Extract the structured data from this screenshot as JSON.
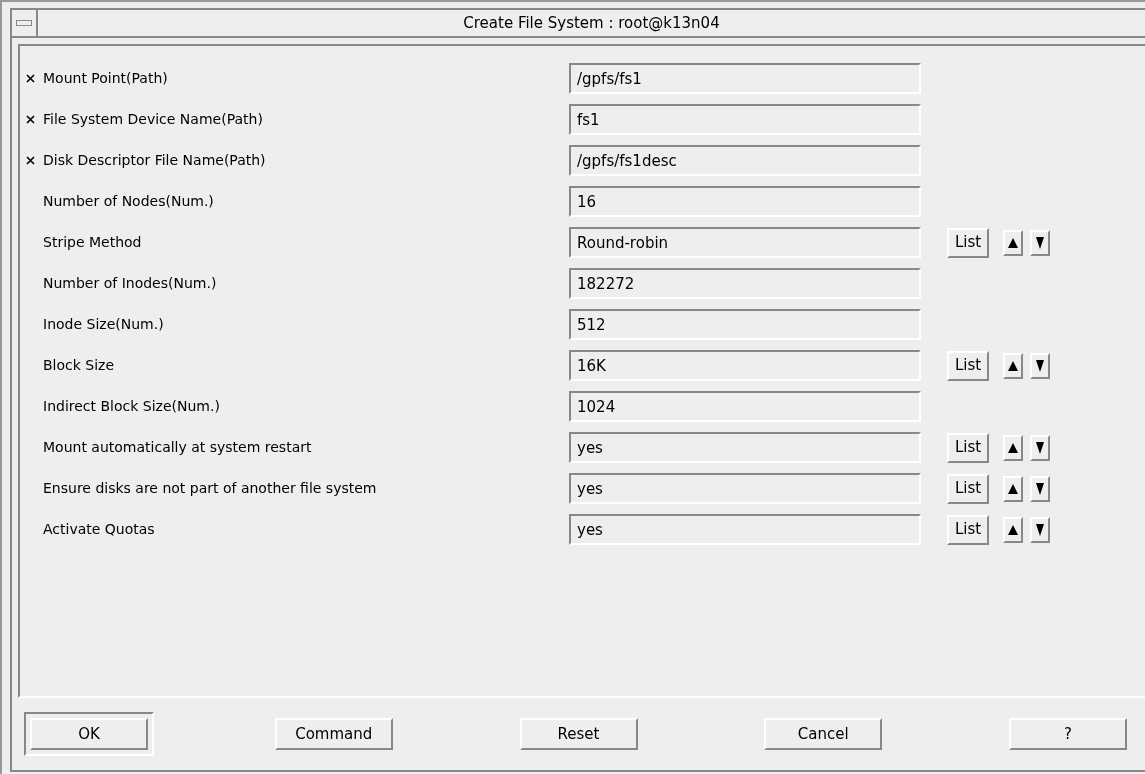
{
  "window": {
    "title": "Create File System : root@k13n04"
  },
  "fields": [
    {
      "label": "Mount Point(Path)",
      "required": true,
      "value": "/gpfs/fs1",
      "has_list": false
    },
    {
      "label": "File System Device Name(Path)",
      "required": true,
      "value": "fs1",
      "has_list": false
    },
    {
      "label": "Disk Descriptor File Name(Path)",
      "required": true,
      "value": "/gpfs/fs1desc",
      "has_list": false
    },
    {
      "label": "Number of Nodes(Num.)",
      "required": false,
      "value": "16",
      "has_list": false
    },
    {
      "label": "Stripe Method",
      "required": false,
      "value": "Round-robin",
      "has_list": true,
      "list_button": "List"
    },
    {
      "label": "Number of Inodes(Num.)",
      "required": false,
      "value": "182272",
      "has_list": false
    },
    {
      "label": "Inode Size(Num.)",
      "required": false,
      "value": "512",
      "has_list": false
    },
    {
      "label": "Block Size",
      "required": false,
      "value": "16K",
      "has_list": true,
      "list_button": "List"
    },
    {
      "label": "Indirect Block Size(Num.)",
      "required": false,
      "value": "1024",
      "has_list": false
    },
    {
      "label": "Mount automatically at system restart",
      "required": false,
      "value": "yes",
      "has_list": true,
      "list_button": "List"
    },
    {
      "label": "Ensure disks are not part of another file system",
      "required": false,
      "value": "yes",
      "has_list": true,
      "list_button": "List"
    },
    {
      "label": "Activate Quotas",
      "required": false,
      "value": "yes",
      "has_list": true,
      "list_button": "List"
    }
  ],
  "buttons": [
    {
      "label": "OK",
      "default": true
    },
    {
      "label": "Command",
      "default": false
    },
    {
      "label": "Reset",
      "default": false
    },
    {
      "label": "Cancel",
      "default": false
    },
    {
      "label": "?",
      "default": false
    }
  ]
}
